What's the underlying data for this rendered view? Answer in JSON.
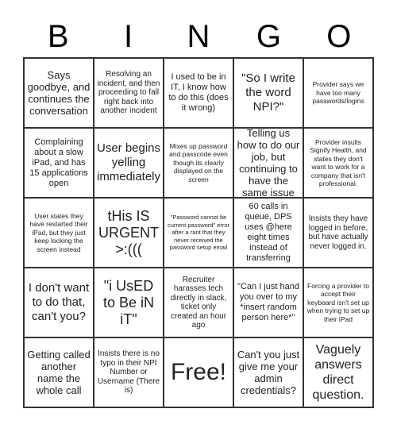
{
  "header": {
    "letters": [
      "B",
      "I",
      "N",
      "G",
      "O"
    ]
  },
  "cells": [
    "Says goodbye, and continues the conversation",
    "Resolving an incident, and then proceeding to fall right back into another incident",
    "I used to be in IT, I know how to do this (does it wrong)",
    "\"So I write the word NPI?\"",
    "Provider says we have too many passwords/logins",
    "Complaining about a slow iPad, and has 15 applications open",
    "User begins yelling immediately",
    "Mixes up password and passcode even though its clearly displayed on the screen",
    "Telling us how to do our job, but continuing to have the same issue",
    "Provider insults Signify Health, and states they don't want to work for a company that isn't professional.",
    "User states they have restarted their iPad, but they just keep locking the screen instead",
    "tHis IS URGENT >:(((",
    "\"Password cannot be current password\" error after a rant that they never received the password setup email",
    "60 calls in queue, DPS uses @here eight times instead of transferring",
    "Insists they have logged in before, but have actually never logged in.",
    "I don't want to do that, can't you?",
    "\"i UsED to Be iN iT\"",
    "Recruiter harasses tech directly in slack, ticket only created an hour ago",
    "\"Can I just hand you over to my *insert random person here*\"",
    "Forcing a provider to accept their keyboard isn't set up when trying to set up their iPad",
    "Getting called another name the whole call",
    "Insists there is no typo in their NPI Number or Username (There is)",
    "Free!",
    "Can't you just give me your admin credentials?",
    "Vaguely answers direct question."
  ]
}
